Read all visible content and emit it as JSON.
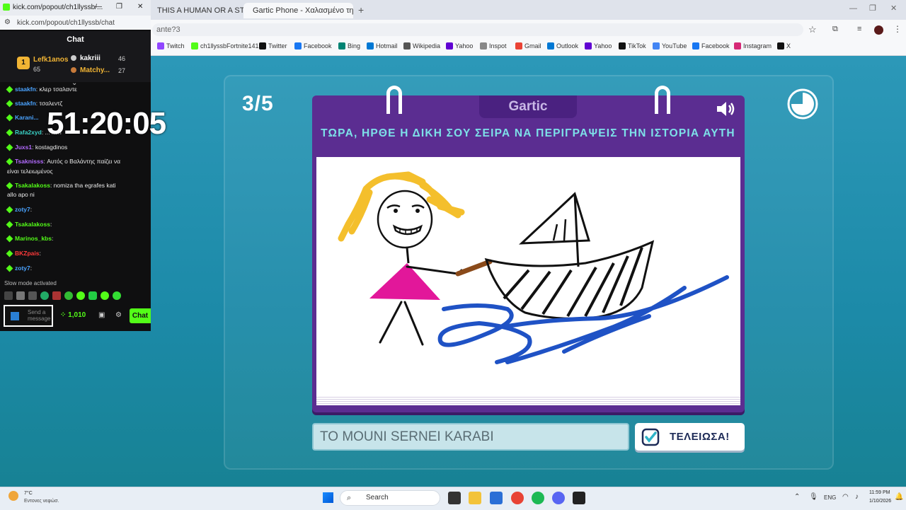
{
  "browser": {
    "tabs": [
      {
        "label": "THIS A HUMAN OR A STREA"
      },
      {
        "label": "Gartic Phone - Χαλασμένο τηλ"
      }
    ],
    "url": "ante?3",
    "bookmarks": [
      "Twitch",
      "ch1llyssbFortnite141",
      "Twitter",
      "Facebook",
      "Bing",
      "Hotmail",
      "Wikipedia",
      "Yahoo",
      "Inspot",
      "Gmail",
      "Outlook",
      "Yahoo",
      "TikTok",
      "YouTube",
      "Facebook",
      "Instagram",
      "X"
    ]
  },
  "kick": {
    "window_title": "kick.com/popout/ch1llyssb/...",
    "url": "kick.com/popout/ch1llyssb/chat",
    "header": "Chat",
    "leaders": [
      {
        "rank": "1",
        "name": "Lefk1anos",
        "points": "65"
      },
      {
        "name": "kakriii",
        "points": "46"
      },
      {
        "name": "Matchy...",
        "points": "27"
      }
    ],
    "messages": [
      {
        "user": "staakfn",
        "user_color": "#4aa3ff",
        "text": ": κλερ τσαλαντε"
      },
      {
        "user": "staakfn",
        "user_color": "#4aa3ff",
        "text": ": τσαλεντζ"
      },
      {
        "user": "Karani...",
        "user_color": "#4aa3ff",
        "text": ""
      },
      {
        "user": "Rafa2xyd",
        "user_color": "#3ad1c5",
        "text": ": ... xen"
      },
      {
        "user": "Juxs1",
        "user_color": "#b36bff",
        "text": ": kostagdinos"
      },
      {
        "user": "Tsaknisss",
        "user_color": "#b36bff",
        "text": ": Αυτός ο Βαλάντης παίζει να"
      },
      {
        "user": "",
        "user_color": "#e8e8e8",
        "text": "είναι τελειωμένος"
      },
      {
        "user": "Tsakalakoss",
        "user_color": "#53fc18",
        "text": ": nomiza tha egrafes kati"
      },
      {
        "user": "",
        "user_color": "#e8e8e8",
        "text": "allo apo ni"
      },
      {
        "user": "zoty7",
        "user_color": "#4aa3ff",
        "text": ":"
      },
      {
        "user": "Tsakalakoss",
        "user_color": "#53fc18",
        "text": ":"
      },
      {
        "user": "Marinos_kbs",
        "user_color": "#53fc18",
        "text": ":"
      },
      {
        "user": "BKZpais",
        "user_color": "#ff3b3b",
        "text": ":"
      },
      {
        "user": "zoty7",
        "user_color": "#4aa3ff",
        "text": ":"
      }
    ],
    "slow_mode": "Slow mode activated",
    "input_placeholder": "Send a message",
    "points_balance": "1,010",
    "chat_button": "Chat"
  },
  "stream_timer": "51:20:05",
  "game": {
    "round": "3/5",
    "logo": "Gartic",
    "prompt": "ΤΩΡΑ, ΗΡΘΕ Η ΔΙΚΗ ΣΟΥ ΣΕΙΡΑ ΝΑ ΠΕΡΙΓΡΑΨΕΙΣ ΤΗΝ ΙΣΤΟΡΙΑ ΑΥΤΗ",
    "answer_value": "TO MOUNI SERNEI KARABI",
    "done_button": "ΤΕΛΕΙΩΣΑ!"
  },
  "taskbar": {
    "weather_temp": "7°C",
    "weather_desc": "Εντονες νεφώσ.",
    "search_placeholder": "Search",
    "language": "ENG",
    "time": "11:59 PM",
    "date": "1/10/2026"
  },
  "colors": {
    "card_purple": "#5b2d91",
    "prompt_cyan": "#7de0e8",
    "kick_green": "#53fc18",
    "game_bg": "#1e8fa8"
  }
}
